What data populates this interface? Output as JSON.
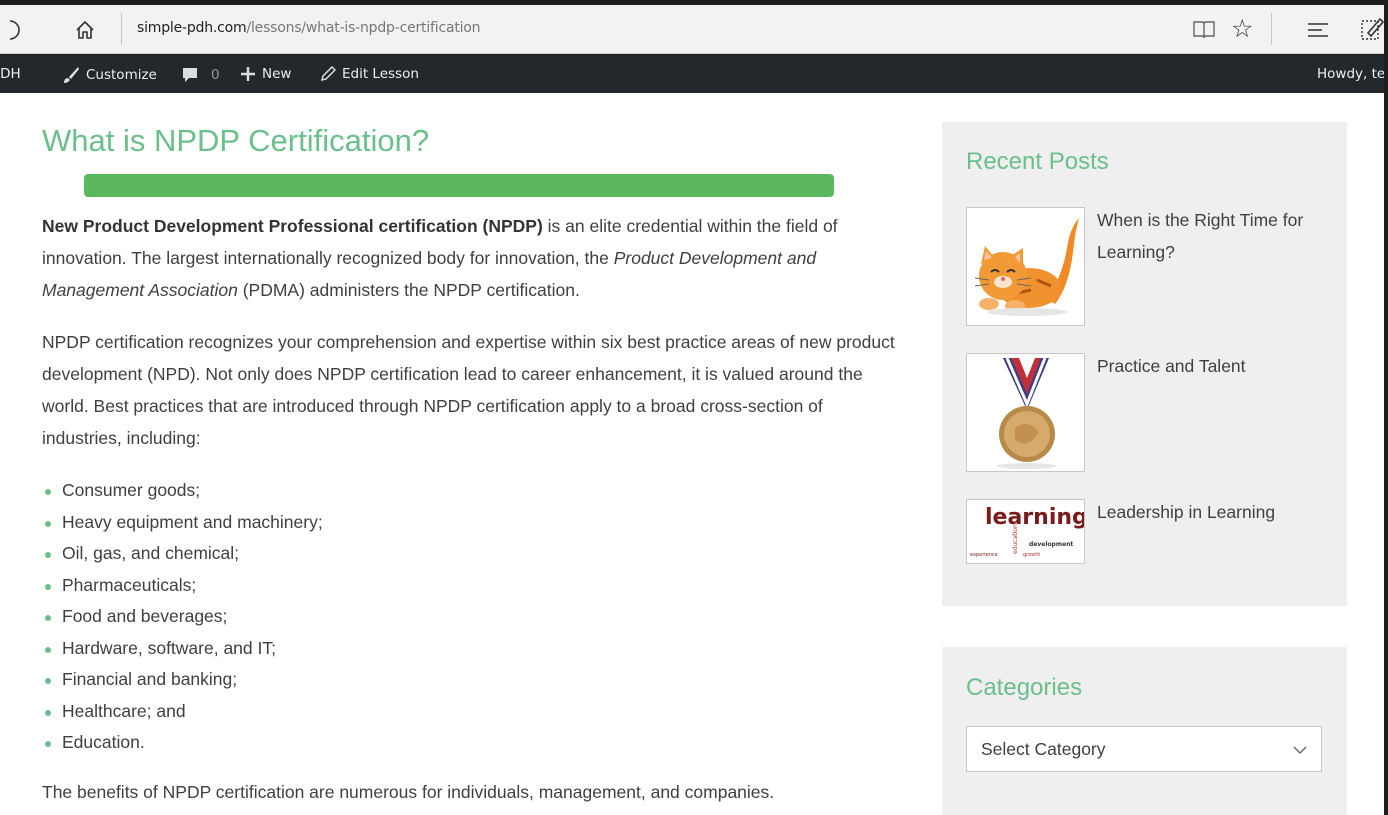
{
  "browser": {
    "address_host": "simple-pdh.com",
    "address_path": "/lessons/what-is-npdp-certification"
  },
  "admin_bar": {
    "site_label": "PDH",
    "customize": "Customize",
    "comments_count": "0",
    "new": "New",
    "edit": "Edit Lesson",
    "howdy": "Howdy, te"
  },
  "lesson": {
    "title": "What is NPDP Certification?",
    "progress_percent": 100,
    "p1_bold": "New Product Development Professional certification (NPDP)",
    "p1_a": " is an elite credential within the field of innovation.  The largest internationally recognized body for innovation, the ",
    "p1_italic": "Product Development and Management Association",
    "p1_b": " (PDMA) administers the NPDP certification.",
    "p2": "NPDP certification recognizes your comprehension and expertise within six best practice areas of new product development (NPD).  Not only does NPDP certification lead to career enhancement, it is valued around the world.  Best practices that are introduced through NPDP certification apply to a broad cross-section of industries, including:",
    "industries": [
      "Consumer goods;",
      "Heavy equipment and machinery;",
      "Oil, gas, and chemical;",
      "Pharmaceuticals;",
      "Food and beverages;",
      "Hardware, software, and IT;",
      "Financial and banking;",
      "Healthcare; and",
      "Education."
    ],
    "p3": "The benefits of NPDP certification are numerous for individuals, management, and companies."
  },
  "sidebar": {
    "recent_title": "Recent Posts",
    "posts": [
      {
        "title": "When is the Right Time for Learning?",
        "thumb": "cat-illustration"
      },
      {
        "title": "Practice and Talent",
        "thumb": "medal"
      },
      {
        "title": "Leadership in Learning",
        "thumb": "learning-word-cloud"
      }
    ],
    "thumb_words": {
      "learning": "learning",
      "development": "development",
      "experience": "experience",
      "education": "education",
      "growth": "growth"
    },
    "categories_title": "Categories",
    "category_select": "Select Category"
  },
  "colors": {
    "accent_green": "#6bbf8a",
    "progress_green": "#5cb85c",
    "admin_bar": "#23282d"
  }
}
